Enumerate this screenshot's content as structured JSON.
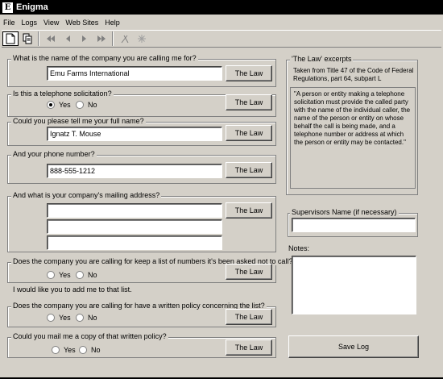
{
  "window": {
    "title": "Enigma",
    "logo_letter": "E"
  },
  "menu": [
    "File",
    "Logs",
    "View",
    "Web Sites",
    "Help"
  ],
  "toolbar": {
    "icons": [
      "new-document-icon",
      "copy-document-icon",
      "first-record-icon",
      "previous-record-icon",
      "next-record-icon",
      "last-record-icon",
      "cut-icon",
      "snowflake-icon"
    ]
  },
  "law_button": "The Law",
  "q_company": {
    "label": "What is the name of the company you are calling me for?",
    "value": "Emu Farms International"
  },
  "q_solicitation": {
    "label": "Is this a telephone solicitation?",
    "yes": "Yes",
    "no": "No",
    "selected": "Yes"
  },
  "q_name": {
    "label": "Could you please tell me your full name?",
    "value": "Ignatz T. Mouse"
  },
  "q_phone": {
    "label": "And your phone number?",
    "value": "888-555-1212"
  },
  "q_address": {
    "label": "And what is your company's mailing address?",
    "line1": "",
    "line2": "",
    "line3": ""
  },
  "q_list": {
    "label": "Does the company you are calling for keep a list of numbers it's been asked not to call?",
    "yes": "Yes",
    "no": "No"
  },
  "add_me_text": "I would like you to add me to that list.",
  "q_policy": {
    "label": "Does the company you are calling for have a written policy concerning the list?",
    "yes": "Yes",
    "no": "No"
  },
  "q_mail": {
    "label": "Could you mail me a copy of that written policy?",
    "yes": "Yes",
    "no": "No"
  },
  "law_excerpts": {
    "title": "'The Law' excerpts",
    "source": "Taken from Title 47 of the Code of Federal Regulations, part 64, subpart L",
    "quote": "\"A person or entity making a telephone solicitation must provide the called party with the name of the individual caller, the name of the person or entity on whose behalf the call is being made, and a telephone number or address at which the person or entity may be contacted.\""
  },
  "supervisor": {
    "label": "Supervisors Name (if necessary)",
    "value": ""
  },
  "notes": {
    "label": "Notes:"
  },
  "save_log": "Save Log"
}
